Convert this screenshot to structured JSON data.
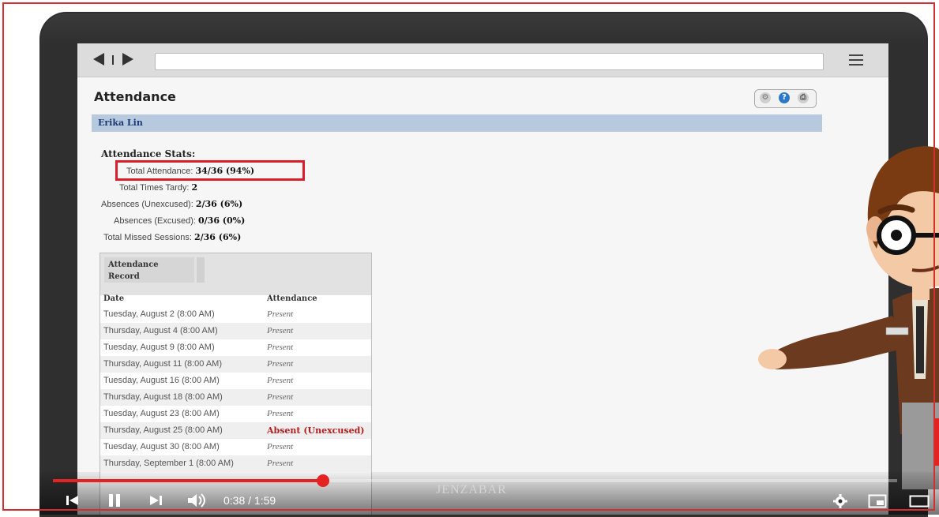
{
  "page": {
    "title": "Attendance",
    "student_name": "Erika Lin"
  },
  "toolbar": {
    "icons": [
      "gear-icon",
      "help-icon",
      "print-icon"
    ]
  },
  "stats": {
    "heading": "Attendance Stats:",
    "items": [
      {
        "label": "Total Attendance:",
        "value": "34/36 (94%)"
      },
      {
        "label": "Total Times Tardy:",
        "value": "2"
      },
      {
        "label": "Absences (Unexcused):",
        "value": "2/36 (6%)"
      },
      {
        "label": "Absences (Excused):",
        "value": "0/36 (0%)"
      },
      {
        "label": "Total Missed Sessions:",
        "value": "2/36 (6%)"
      }
    ]
  },
  "record": {
    "tab_label_line1": "Attendance",
    "tab_label_line2": "Record",
    "columns": [
      "Date",
      "Attendance"
    ],
    "rows": [
      {
        "date": "Tuesday, August 2 (8:00 AM)",
        "status": "Present"
      },
      {
        "date": "Thursday, August 4 (8:00 AM)",
        "status": "Present"
      },
      {
        "date": "Tuesday, August 9 (8:00 AM)",
        "status": "Present"
      },
      {
        "date": "Thursday, August 11 (8:00 AM)",
        "status": "Present"
      },
      {
        "date": "Tuesday, August 16 (8:00 AM)",
        "status": "Present"
      },
      {
        "date": "Thursday, August 18 (8:00 AM)",
        "status": "Present"
      },
      {
        "date": "Tuesday, August 23 (8:00 AM)",
        "status": "Present"
      },
      {
        "date": "Thursday, August 25 (8:00 AM)",
        "status": "Absent (Unexcused)"
      },
      {
        "date": "Tuesday, August 30 (8:00 AM)",
        "status": "Present"
      },
      {
        "date": "Thursday, September 1 (8:00 AM)",
        "status": "Present"
      }
    ]
  },
  "player": {
    "time_display": "0:38 / 1:59",
    "progress": 0.32,
    "watermark": "JENZABAR"
  },
  "colors": {
    "accent": "#e52222",
    "highlight_box": "#d9202a",
    "name_band": "#b7c9de",
    "absent_text": "#b71c1c"
  }
}
